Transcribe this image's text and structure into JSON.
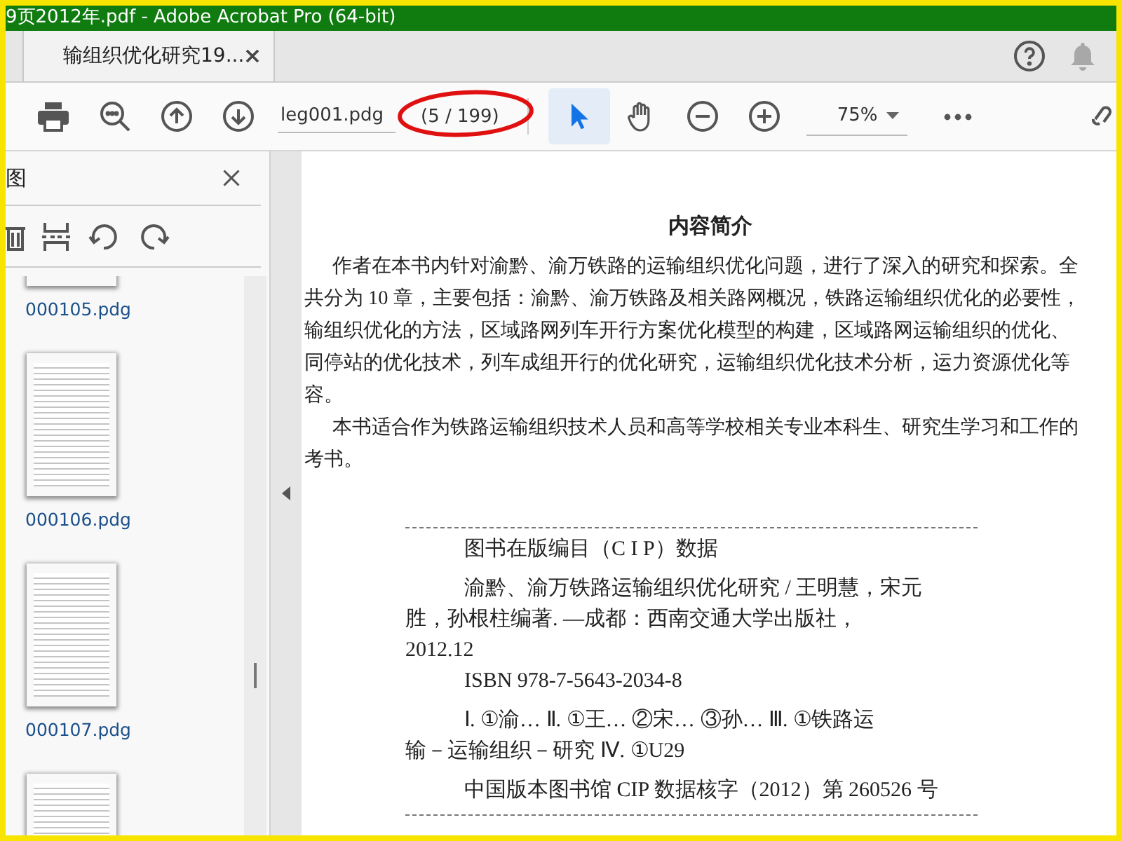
{
  "window": {
    "title": "9页2012年.pdf - Adobe Acrobat Pro (64-bit)"
  },
  "tabs": [
    {
      "label": "输组织优化研究19...",
      "selected": true
    }
  ],
  "toolbar": {
    "page_field": {
      "value": "leg001.pdg"
    },
    "page_count": "(5 / 199)",
    "tools": [
      {
        "kind": "select",
        "selected": true
      },
      {
        "kind": "hand",
        "selected": false
      }
    ],
    "zoom": {
      "value": "75%"
    }
  },
  "sidebar": {
    "title": "图",
    "thumbnails": [
      {
        "label": "000105.pdg"
      },
      {
        "label": "000106.pdg"
      },
      {
        "label": "000107.pdg"
      }
    ]
  },
  "page": {
    "heading": "内容简介",
    "summary_lines": [
      {
        "text": "作者在本书内针对渝黔、渝万铁路的运输组织优化问题，进行了深入的研究和探索。全",
        "indent": true
      },
      {
        "text": "共分为 10 章，主要包括：渝黔、渝万铁路及相关路网概况，铁路运输组织优化的必要性，",
        "indent": false
      },
      {
        "text": "输组织优化的方法，区域路网列车开行方案优化模型的构建，区域路网运输组织的优化、",
        "indent": false
      },
      {
        "text": "同停站的优化技术，列车成组开行的优化研究，运输组织优化技术分析，运力资源优化等",
        "indent": false
      },
      {
        "text": "容。",
        "indent": false
      },
      {
        "text": "本书适合作为铁路运输组织技术人员和高等学校相关专业本科生、研究生学习和工作的",
        "indent": true
      },
      {
        "text": "考书。",
        "indent": false
      }
    ],
    "cip": {
      "title": "图书在版编目（C I P）数据",
      "blocks": [
        [
          {
            "text": "渝黔、渝万铁路运输组织优化研究 / 王明慧，宋元",
            "indent": true
          },
          {
            "text": "胜，孙根柱编著. —成都：西南交通大学出版社，",
            "indent": false
          },
          {
            "text": "2012.12",
            "indent": false
          },
          {
            "text": "ISBN 978-7-5643-2034-8",
            "indent": true
          }
        ],
        [
          {
            "text": "Ⅰ. ①渝…  Ⅱ. ①王…  ②宋…  ③孙…  Ⅲ. ①铁路运",
            "indent": true
          },
          {
            "text": "输－运输组织－研究  Ⅳ. ①U29",
            "indent": false
          }
        ],
        [
          {
            "text": "中国版本图书馆 CIP 数据核字（2012）第 260526 号",
            "indent": true
          }
        ]
      ]
    }
  }
}
